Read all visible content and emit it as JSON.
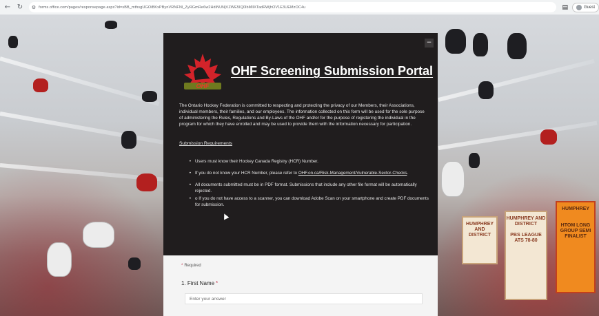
{
  "browser": {
    "back_icon": "arrow-left-icon",
    "reload_icon": "reload-icon",
    "url": "forms.office.com/pages/responsepage.aspx?id=sBB_mthsgUGOiBKxPBynVRNFNl_ZyRGmRe6w2HdiNUNjVZWE5IQ0lbMlIXTadRWjhOV1E3UEMzOC4u",
    "profile_label": "Guest"
  },
  "form": {
    "collapse_label": "−",
    "title": "OHF Screening Submission Portal",
    "logo_text": "OHF",
    "intro": "The Ontario Hockey Federation is committed to respecting and protecting the privacy of our Members, their Associations, individual members, their families, and our employees. The information collected on this form will be used for the sole purpose of administering the Rules, Regulations and By-Laws of the OHF and/or for the purpose of registering the individual in the program for which they have enrolled and may be used to provide them with the information necessary for participation.",
    "requirements_heading": "Submission Requirements",
    "requirements": {
      "r1": "Users must know their Hockey Canada Registry (HCR) Number.",
      "r2_prefix": "If you do not know your HCR Number, please refer to ",
      "r2_link": "OHF.on.ca/Risk-Management/Vulnerable-Sector-Checks",
      "r2_suffix": ".",
      "r3": "All documents submitted must be in PDF format. Submissions that include any other file format will be automatically rejected.",
      "r4": "o  If you do not have access to a scanner, you can download Adobe Scan on your smartphone and create PDF documents for submission."
    },
    "required_note": "Required",
    "question_1": {
      "number": "1.",
      "label": "First Name",
      "placeholder": "Enter your answer"
    }
  },
  "background": {
    "banner_1": "HUMPHREY AND DISTRICT",
    "banner_2": "HUMPHREY AND DISTRICT",
    "banner_3": "HUMPHREY",
    "banner_2_lower": "PBS LEAGUE ATS 78-80",
    "banner_3_lower": "HTOM LONG GROUP SEMI FINALIST"
  },
  "colors": {
    "card_bg": "#201d1e",
    "accent_red": "#c4314b",
    "banner_orange": "#f08a1f"
  }
}
